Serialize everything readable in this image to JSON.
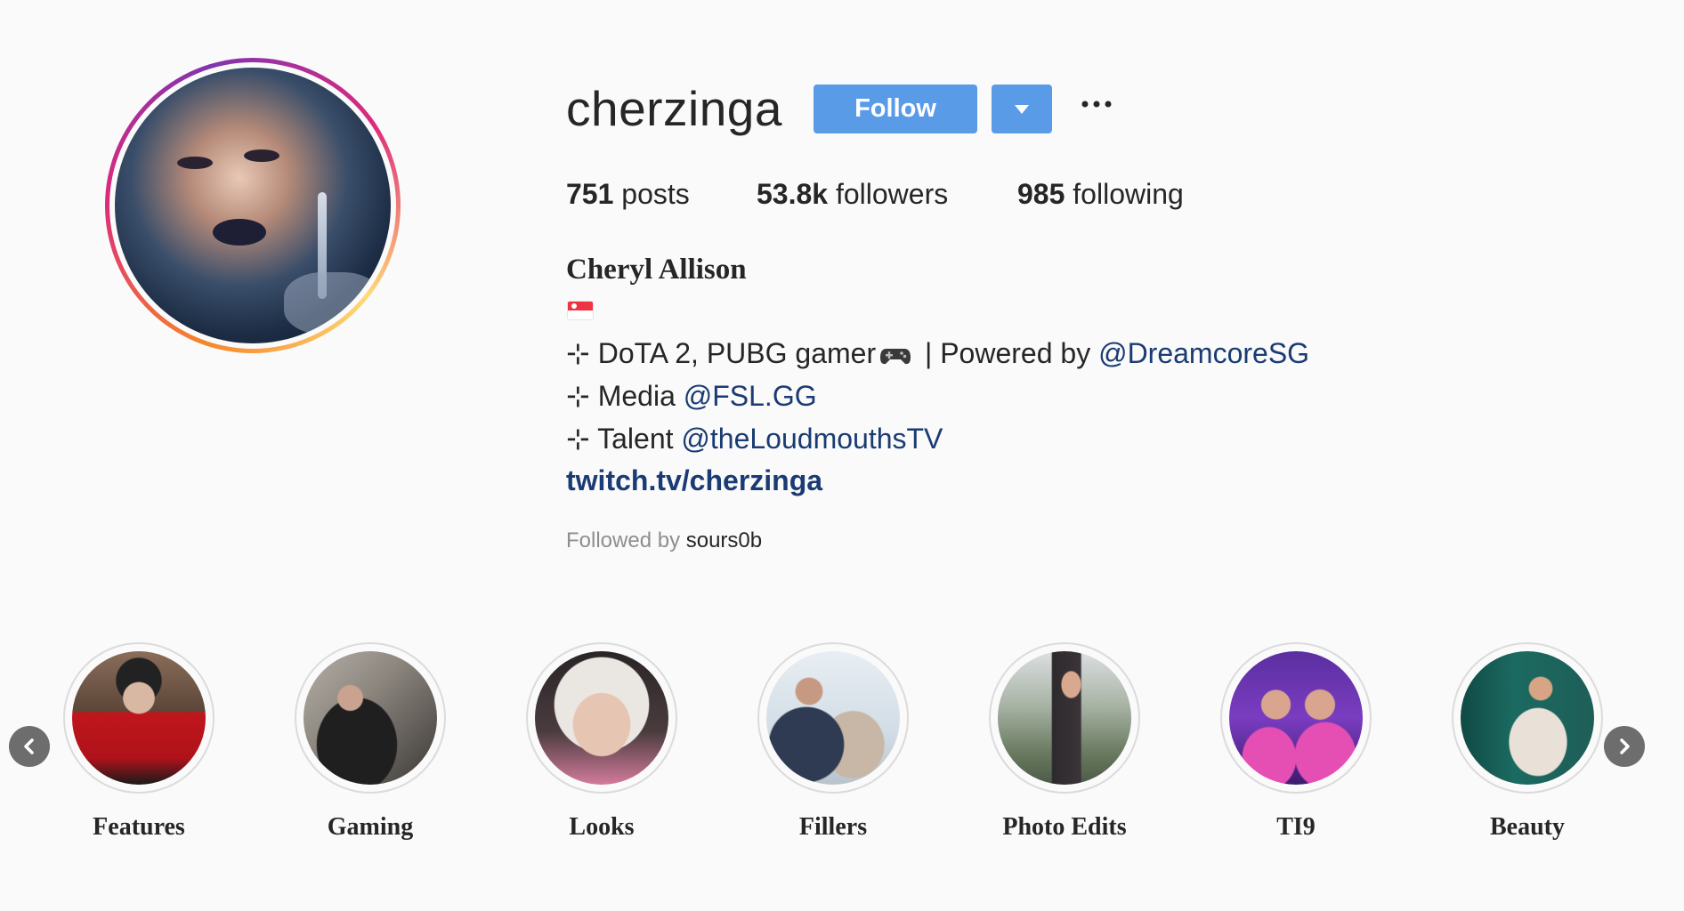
{
  "profile": {
    "username": "cherzinga",
    "follow_label": "Follow",
    "stats": {
      "posts_count": "751",
      "posts_label": "posts",
      "followers_count": "53.8k",
      "followers_label": "followers",
      "following_count": "985",
      "following_label": "following"
    },
    "full_name": "Cheryl Allison",
    "bio": {
      "line1_prefix": "⊹ DoTA 2, PUBG gamer",
      "line1_middle": " | Powered by ",
      "line1_mention": "@DreamcoreSG",
      "line2_prefix": "⊹ Media ",
      "line2_mention": "@FSL.GG",
      "line3_prefix": "⊹ Talent ",
      "line3_mention": "@theLoudmouthsTV",
      "website": "twitch.tv/cherzinga"
    },
    "followed_by_label": "Followed by",
    "followed_by_user": "sours0b"
  },
  "highlights": [
    {
      "label": "Features"
    },
    {
      "label": "Gaming"
    },
    {
      "label": "Looks"
    },
    {
      "label": "Fillers"
    },
    {
      "label": "Photo Edits"
    },
    {
      "label": "TI9"
    },
    {
      "label": "Beauty"
    }
  ],
  "colors": {
    "accent": "#5a9be8",
    "mention": "#1a3b73",
    "background": "#fafafa"
  }
}
